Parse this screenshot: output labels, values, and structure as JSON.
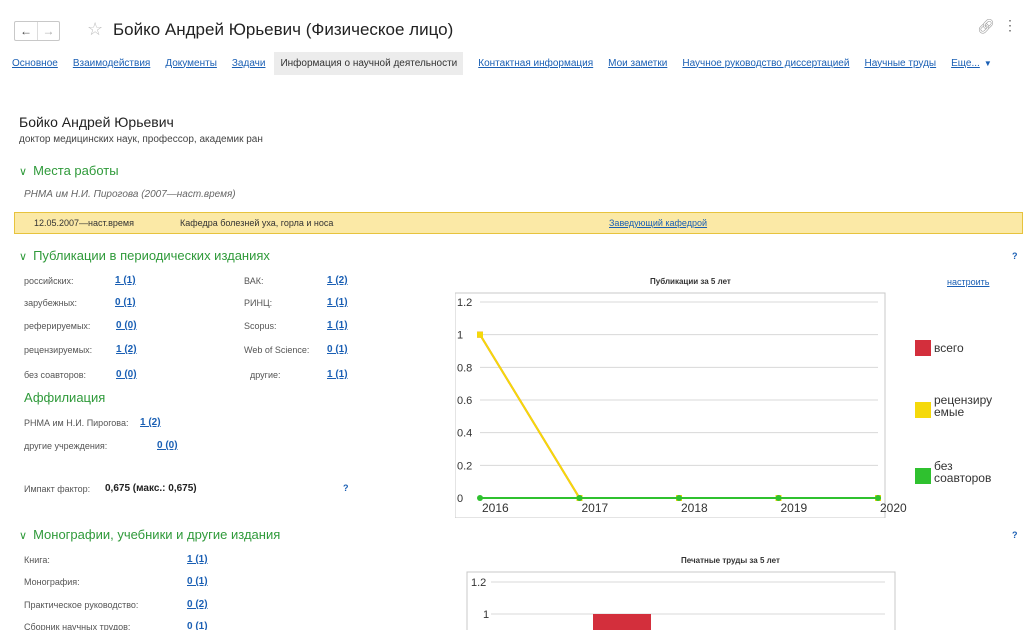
{
  "window": {
    "title": "Бойко Андрей Юрьевич (Физическое лицо)",
    "back_icon": "arrow-left",
    "forward_icon": "arrow-right",
    "favorite_icon": "star",
    "link_icon": "link",
    "more_icon": "vertical-dots"
  },
  "tabs": [
    {
      "label": "Основное",
      "active": false
    },
    {
      "label": "Взаимодействия",
      "active": false
    },
    {
      "label": "Документы",
      "active": false
    },
    {
      "label": "Задачи",
      "active": false
    },
    {
      "label": "Информация о научной деятельности",
      "active": true
    },
    {
      "label": "Контактная информация",
      "active": false
    },
    {
      "label": "Мои заметки",
      "active": false
    },
    {
      "label": "Научное руководство диссертацией",
      "active": false
    },
    {
      "label": "Научные труды",
      "active": false
    }
  ],
  "tabs_more": "Еще...",
  "person": {
    "name": "Бойко Андрей Юрьевич",
    "title": "доктор медицинских наук, профессор, академик ран"
  },
  "workplaces": {
    "heading": "Места работы",
    "org": "РНМА им Н.И. Пирогова (2007—наст.время)",
    "job": {
      "period": "12.05.2007—наст.время",
      "department": "Кафедра болезней уха, горла и носа",
      "position": "Заведующий кафедрой"
    }
  },
  "publications": {
    "heading": "Публикации в периодических изданиях",
    "help": "?",
    "left": [
      {
        "label": "российских:",
        "value": "1 (1)"
      },
      {
        "label": "зарубежных:",
        "value": "0 (1)"
      },
      {
        "label": "реферируемых:",
        "value": "0 (0)"
      },
      {
        "label": "рецензируемых:",
        "value": "1 (2)"
      },
      {
        "label": "без соавторов:",
        "value": "0 (0)"
      }
    ],
    "right": [
      {
        "label": "ВАК:",
        "value": "1 (2)"
      },
      {
        "label": "РИНЦ:",
        "value": "1 (1)"
      },
      {
        "label": "Scopus:",
        "value": "1 (1)"
      },
      {
        "label": "Web of Science:",
        "value": "0 (1)"
      },
      {
        "label": "другие:",
        "value": "1 (1)"
      }
    ],
    "affiliation": {
      "heading": "Аффилиация",
      "rows": [
        {
          "label": "РНМА им Н.И. Пирогова:",
          "value": "1 (2)"
        },
        {
          "label": "другие учреждения:",
          "value": "0 (0)"
        }
      ]
    },
    "impact_label": "Импакт фактор:",
    "impact_value": "0,675 (макс.: 0,675)",
    "impact_help": "?",
    "configure": "настроить"
  },
  "monographs": {
    "heading": "Монографии, учебники и другие издания",
    "help": "?",
    "rows": [
      {
        "label": "Книга:",
        "value": "1 (1)"
      },
      {
        "label": "Монография:",
        "value": "0 (1)"
      },
      {
        "label": "Практическое руководство:",
        "value": "0 (2)"
      },
      {
        "label": "Сборник научных трудов:",
        "value": "0 (1)"
      }
    ]
  },
  "chart_data": [
    {
      "type": "line",
      "title": "Публикации за 5 лет",
      "x": [
        "2016",
        "2017",
        "2018",
        "2019",
        "2020"
      ],
      "ylim": [
        0,
        1.2
      ],
      "yticks": [
        "0",
        "0.2",
        "0.4",
        "0.6",
        "0.8",
        "1",
        "1.2"
      ],
      "grid": true,
      "legend": "right",
      "series": [
        {
          "name": "всего",
          "color": "#d32f3c",
          "values": [
            1,
            0,
            0,
            0,
            0
          ]
        },
        {
          "name": "рецензируемые",
          "color": "#f5d90a",
          "values": [
            1,
            0,
            0,
            0,
            0
          ]
        },
        {
          "name": "без соавторов",
          "color": "#2fc12f",
          "values": [
            0,
            0,
            0,
            0,
            0
          ]
        }
      ]
    },
    {
      "type": "bar",
      "title": "Печатные труды  за 5 лет",
      "yticks": [
        "1",
        "1.2"
      ],
      "ylim": [
        0,
        1.2
      ],
      "visible_bar": {
        "color": "#d32f3c",
        "value": 1
      }
    }
  ]
}
